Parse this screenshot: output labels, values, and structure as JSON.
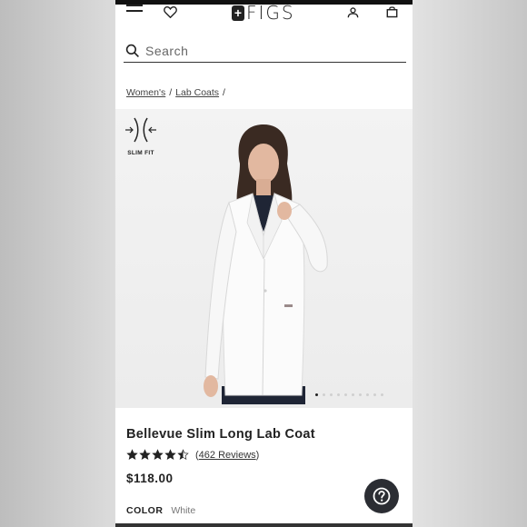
{
  "header": {
    "logo_text": "FIGS",
    "icons": [
      "menu-icon",
      "heart-icon",
      "user-icon",
      "bag-icon"
    ]
  },
  "search": {
    "placeholder": "Search"
  },
  "breadcrumb": {
    "items": [
      "Women's",
      "Lab Coats"
    ],
    "separator": "/"
  },
  "hero": {
    "fit_label": "SLIM FIT",
    "carousel_total": 10,
    "carousel_active": 1
  },
  "product": {
    "title": "Bellevue Slim Long Lab Coat",
    "rating": 4.5,
    "reviews_text": "462 Reviews",
    "price": "$118.00",
    "color_label": "COLOR",
    "color_value": "White"
  },
  "colors": {
    "text": "#222222",
    "background": "#ffffff",
    "help_button": "#2b2d33"
  }
}
